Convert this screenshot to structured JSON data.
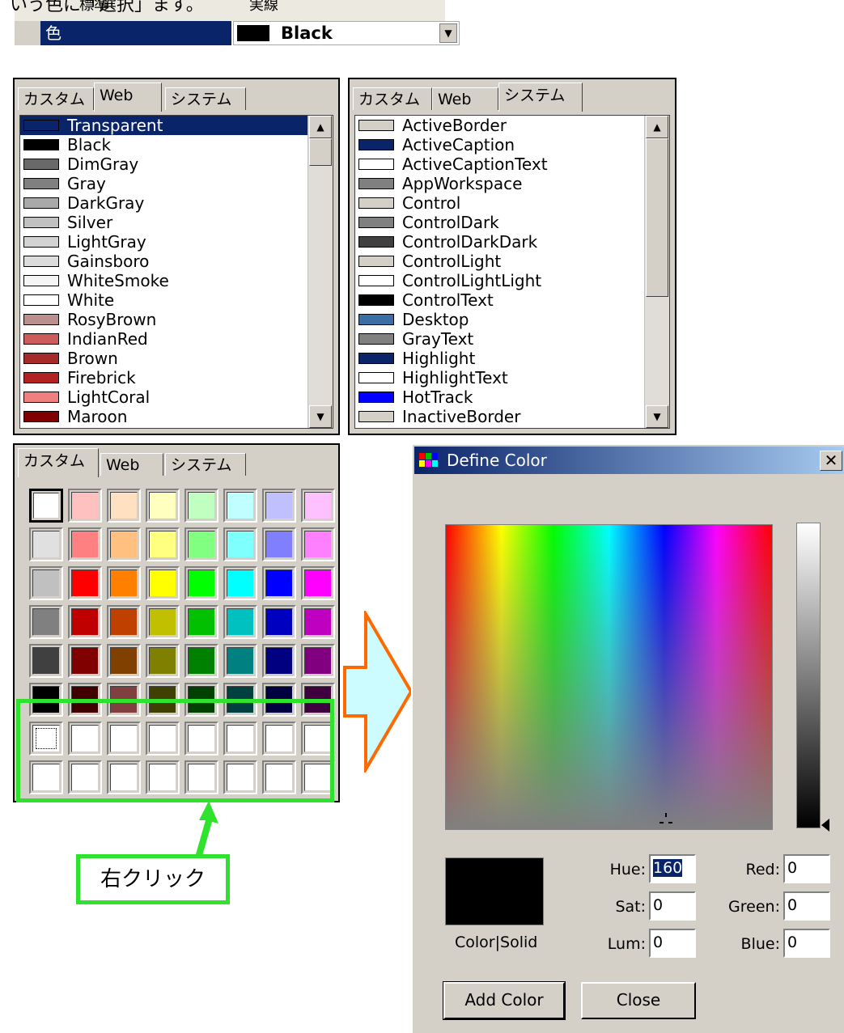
{
  "top": {
    "caption_fragment": "いう色に「選択」ます。",
    "row_prev_name": "標準",
    "row_prev_value": "実線",
    "prop_name": "色",
    "prop_value": "Black",
    "dropdown_icon": "▼"
  },
  "tabs": {
    "custom": "カスタム",
    "web": "Web",
    "system": "システム"
  },
  "web_list": [
    {
      "name": "Transparent",
      "color": "#0a246a"
    },
    {
      "name": "Black",
      "color": "#000000"
    },
    {
      "name": "DimGray",
      "color": "#696969"
    },
    {
      "name": "Gray",
      "color": "#808080"
    },
    {
      "name": "DarkGray",
      "color": "#a9a9a9"
    },
    {
      "name": "Silver",
      "color": "#c0c0c0"
    },
    {
      "name": "LightGray",
      "color": "#d3d3d3"
    },
    {
      "name": "Gainsboro",
      "color": "#dcdcdc"
    },
    {
      "name": "WhiteSmoke",
      "color": "#f5f5f5"
    },
    {
      "name": "White",
      "color": "#ffffff"
    },
    {
      "name": "RosyBrown",
      "color": "#bc8f8f"
    },
    {
      "name": "IndianRed",
      "color": "#cd5c5c"
    },
    {
      "name": "Brown",
      "color": "#a52a2a"
    },
    {
      "name": "Firebrick",
      "color": "#b22222"
    },
    {
      "name": "LightCoral",
      "color": "#f08080"
    },
    {
      "name": "Maroon",
      "color": "#800000"
    }
  ],
  "system_list": [
    {
      "name": "ActiveBorder",
      "color": "#d4d0c8"
    },
    {
      "name": "ActiveCaption",
      "color": "#0a246a"
    },
    {
      "name": "ActiveCaptionText",
      "color": "#ffffff"
    },
    {
      "name": "AppWorkspace",
      "color": "#808080"
    },
    {
      "name": "Control",
      "color": "#d4d0c8"
    },
    {
      "name": "ControlDark",
      "color": "#808080"
    },
    {
      "name": "ControlDarkDark",
      "color": "#404040"
    },
    {
      "name": "ControlLight",
      "color": "#d4d0c8"
    },
    {
      "name": "ControlLightLight",
      "color": "#ffffff"
    },
    {
      "name": "ControlText",
      "color": "#000000"
    },
    {
      "name": "Desktop",
      "color": "#3a6ea5"
    },
    {
      "name": "GrayText",
      "color": "#808080"
    },
    {
      "name": "Highlight",
      "color": "#0a246a"
    },
    {
      "name": "HighlightText",
      "color": "#ffffff"
    },
    {
      "name": "HotTrack",
      "color": "#0000ff"
    },
    {
      "name": "InactiveBorder",
      "color": "#d4d0c8"
    }
  ],
  "custom_palette": [
    [
      "#ffffff",
      "#ffc0c0",
      "#ffe0c0",
      "#ffffc0",
      "#c0ffc0",
      "#c0ffff",
      "#c0c0ff",
      "#ffc0ff"
    ],
    [
      "#e0e0e0",
      "#ff8080",
      "#ffc080",
      "#ffff80",
      "#80ff80",
      "#80ffff",
      "#8080ff",
      "#ff80ff"
    ],
    [
      "#c0c0c0",
      "#ff0000",
      "#ff8000",
      "#ffff00",
      "#00ff00",
      "#00ffff",
      "#0000ff",
      "#ff00ff"
    ],
    [
      "#808080",
      "#c00000",
      "#c04000",
      "#c0c000",
      "#00c000",
      "#00c0c0",
      "#0000c0",
      "#c000c0"
    ],
    [
      "#404040",
      "#800000",
      "#804000",
      "#808000",
      "#008000",
      "#008080",
      "#000080",
      "#800080"
    ],
    [
      "#000000",
      "#400000",
      "#804040",
      "#404000",
      "#004000",
      "#004040",
      "#000040",
      "#400040"
    ],
    [
      "#ffffff",
      "#ffffff",
      "#ffffff",
      "#ffffff",
      "#ffffff",
      "#ffffff",
      "#ffffff",
      "#ffffff"
    ],
    [
      "#ffffff",
      "#ffffff",
      "#ffffff",
      "#ffffff",
      "#ffffff",
      "#ffffff",
      "#ffffff",
      "#ffffff"
    ]
  ],
  "annotation": {
    "label": "右クリック",
    "highlight_color": "#2ee22e",
    "arrow_color": "#ff6a00",
    "arrow_fill": "#ccfcff"
  },
  "dialog": {
    "title": "Define Color",
    "close_icon": "✕",
    "color_solid": "Color|Solid",
    "hue_label": "Hue:",
    "hue_value": "160",
    "sat_label": "Sat:",
    "sat_value": "0",
    "lum_label": "Lum:",
    "lum_value": "0",
    "red_label": "Red:",
    "red_value": "0",
    "green_label": "Green:",
    "green_value": "0",
    "blue_label": "Blue:",
    "blue_value": "0",
    "add_color_label": "Add Color",
    "close_label": "Close"
  }
}
